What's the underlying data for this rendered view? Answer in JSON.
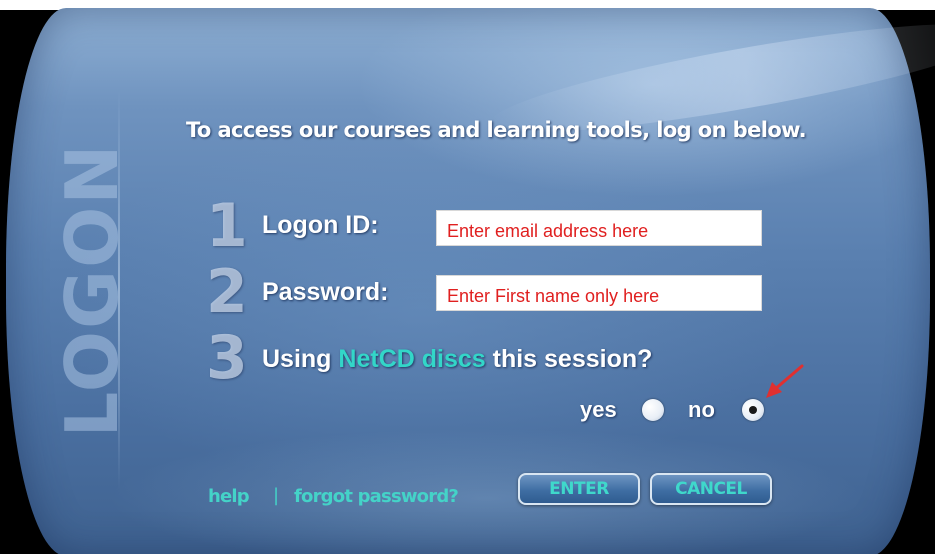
{
  "panel": {
    "watermark": "LOGON",
    "heading": "To access our courses and learning tools, log on below."
  },
  "steps": [
    {
      "number": "1",
      "label": "Logon ID:",
      "placeholder": "Enter email address here"
    },
    {
      "number": "2",
      "label": "Password:",
      "placeholder": "Enter First name only here"
    },
    {
      "number": "3",
      "label_prefix": "Using ",
      "label_highlight": "NetCD discs",
      "label_suffix": " this session?"
    }
  ],
  "netcd_option": {
    "yes_label": "yes",
    "no_label": "no",
    "selected": "no"
  },
  "footer": {
    "help_label": "help",
    "separator": "|",
    "forgot_label": "forgot password?",
    "enter_label": "ENTER",
    "cancel_label": "CANCEL"
  },
  "colors": {
    "accent": "#3fd8cb",
    "field_text": "#e02020",
    "arrow": "#e03030"
  },
  "icons": {
    "annotation": "red-arrow-icon"
  }
}
